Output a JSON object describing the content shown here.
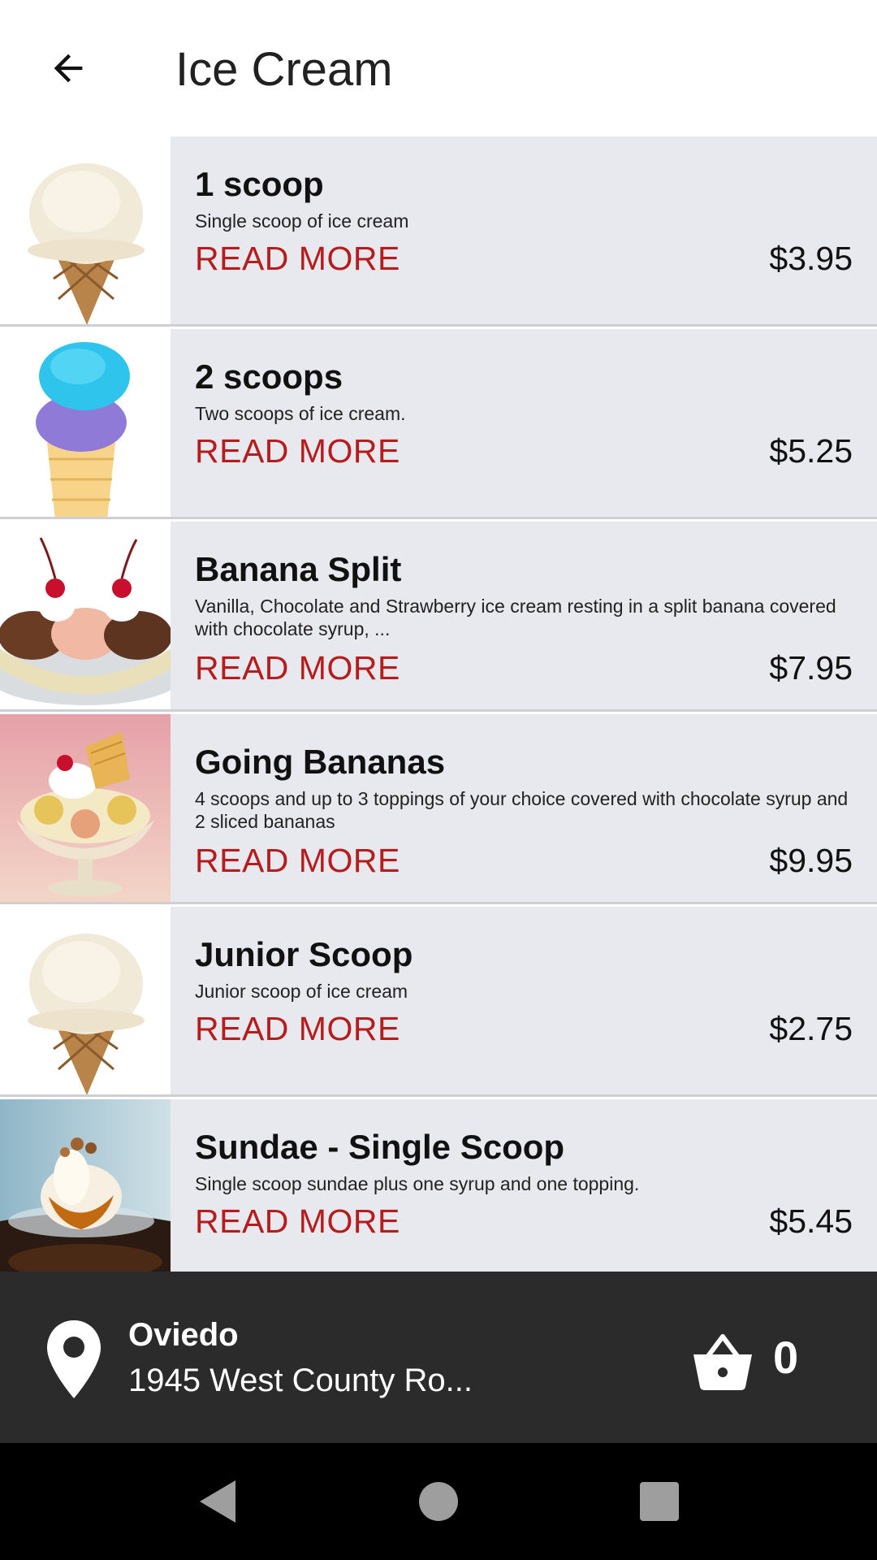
{
  "appbar": {
    "title": "Ice Cream",
    "back_icon": "arrow-left-icon"
  },
  "items": [
    {
      "name": "1 scoop",
      "description": "Single scoop of ice cream",
      "read_more": "READ MORE",
      "price": "$3.95",
      "image": "vanilla-cone"
    },
    {
      "name": "2 scoops",
      "description": "Two scoops of ice cream.",
      "read_more": "READ MORE",
      "price": "$5.25",
      "image": "blue-purple-cone"
    },
    {
      "name": "Banana Split",
      "description": "Vanilla, Chocolate and Strawberry ice cream resting in a split banana covered with chocolate syrup, ...",
      "read_more": "READ MORE",
      "price": "$7.95",
      "image": "banana-split"
    },
    {
      "name": "Going Bananas",
      "description": "4 scoops and up to 3 toppings of your choice covered with chocolate syrup and 2 sliced bananas",
      "read_more": "READ MORE",
      "price": "$9.95",
      "image": "sundae-glass"
    },
    {
      "name": "Junior Scoop",
      "description": "Junior scoop of ice cream",
      "read_more": "READ MORE",
      "price": "$2.75",
      "image": "vanilla-cone"
    },
    {
      "name": "Sundae - Single Scoop",
      "description": "Single scoop sundae plus one syrup and one topping.",
      "read_more": "READ MORE",
      "price": "$5.45",
      "image": "sundae-cup"
    }
  ],
  "footer": {
    "store_name": "Oviedo",
    "store_address": "1945 West County Ro...",
    "cart_count": "0",
    "location_icon": "map-pin-icon",
    "cart_icon": "basket-icon"
  },
  "colors": {
    "accent": "#b71c1c",
    "list_bg": "#e8e8ef",
    "footer_bg": "#2b2b2b"
  }
}
